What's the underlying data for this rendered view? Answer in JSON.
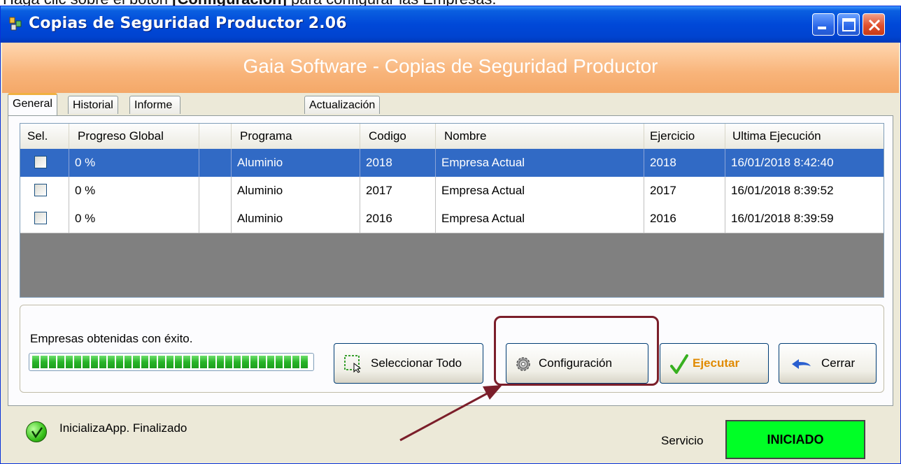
{
  "doc": {
    "prefix": "Haga clic sobre el botón ",
    "strong": "[Configuración]",
    "suffix": " para configurar las Empresas."
  },
  "window": {
    "title": "Copias de Seguridad Productor 2.06",
    "banner": "Gaia Software - Copias de Seguridad Productor"
  },
  "tabs": [
    "General",
    "Historial",
    "Informe del Ultimo Proceso",
    "Actualización"
  ],
  "grid": {
    "columns": [
      "Sel.",
      "Progreso Global",
      "",
      "Programa",
      "Codigo",
      "Nombre",
      "Ejercicio",
      "Ultima Ejecución"
    ],
    "rows": [
      {
        "progress": "0 %",
        "programa": "Aluminio",
        "codigo": "2018",
        "nombre": "Empresa Actual",
        "ejercicio": "2018",
        "ultima": "16/01/2018 8:42:40",
        "selected": true
      },
      {
        "progress": "0 %",
        "programa": "Aluminio",
        "codigo": "2017",
        "nombre": "Empresa Actual",
        "ejercicio": "2017",
        "ultima": "16/01/2018 8:39:52",
        "selected": false
      },
      {
        "progress": "0 %",
        "programa": "Aluminio",
        "codigo": "2016",
        "nombre": "Empresa Actual",
        "ejercicio": "2016",
        "ultima": "16/01/2018 8:39:59",
        "selected": false
      }
    ]
  },
  "status": {
    "message": "Empresas obtenidas con éxito.",
    "progress_fraction": 1.0
  },
  "buttons": {
    "select_all": "Seleccionar Todo",
    "config": "Configuración",
    "run": "Ejecutar",
    "close": "Cerrar"
  },
  "footer": {
    "status": "InicializaApp. Finalizado",
    "service_label": "Servicio",
    "service_state": "INICIADO"
  },
  "colors": {
    "accent": "#316ac5",
    "banner": "#f8b47a",
    "service": "#00ff26",
    "highlight": "#7b1e2a",
    "run_label": "#e08a00"
  },
  "icons": [
    "app-icon",
    "minimize-icon",
    "maximize-icon",
    "close-icon",
    "select-all-icon",
    "gear-icon",
    "checkmark-icon",
    "back-arrow-icon",
    "status-ok-icon"
  ]
}
